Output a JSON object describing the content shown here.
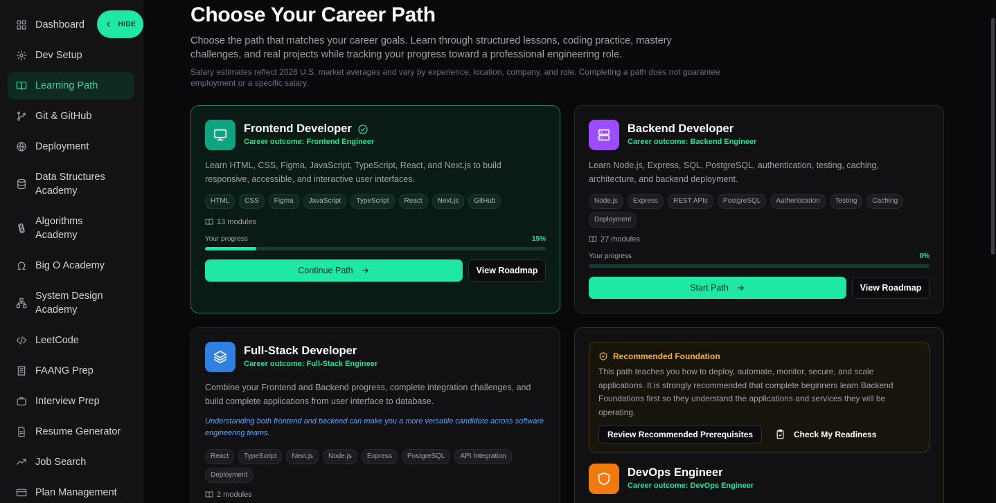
{
  "sidebar": {
    "hide_label": "HIDE",
    "items": [
      {
        "label": "Dashboard",
        "icon": "grid-icon"
      },
      {
        "label": "Dev Setup",
        "icon": "gear-icon"
      },
      {
        "label": "Learning Path",
        "icon": "book-open-icon",
        "active": true
      },
      {
        "label": "Git & GitHub",
        "icon": "git-branch-icon"
      },
      {
        "label": "Deployment",
        "icon": "globe-icon"
      },
      {
        "label": "Data Structures Academy",
        "icon": "database-icon"
      },
      {
        "label": "Algorithms Academy",
        "icon": "atom-icon"
      },
      {
        "label": "Big O Academy",
        "icon": "omega-icon"
      },
      {
        "label": "System Design Academy",
        "icon": "network-icon"
      },
      {
        "label": "LeetCode",
        "icon": "code-icon"
      },
      {
        "label": "FAANG Prep",
        "icon": "building-icon"
      },
      {
        "label": "Interview Prep",
        "icon": "briefcase-icon"
      },
      {
        "label": "Resume Generator",
        "icon": "file-icon"
      },
      {
        "label": "Job Search",
        "icon": "trending-icon"
      },
      {
        "label": "Plan Management",
        "icon": "card-icon"
      }
    ]
  },
  "header": {
    "title": "Choose Your Career Path",
    "description": "Choose the path that matches your career goals. Learn through structured lessons, coding practice, mastery challenges, and real projects while tracking your progress toward a professional engineering role.",
    "note": "Salary estimates reflect 2026 U.S. market averages and vary by experience, location, company, and role. Completing a path does not guarantee employment or a specific salary."
  },
  "cards": {
    "frontend": {
      "title": "Frontend Developer",
      "outcome": "Career outcome: Frontend Engineer",
      "description": "Learn HTML, CSS, Figma, JavaScript, TypeScript, React, and Next.js to build responsive, accessible, and interactive user interfaces.",
      "tags": [
        "HTML",
        "CSS",
        "Figma",
        "JavaScript",
        "TypeScript",
        "React",
        "Next.js",
        "GitHub"
      ],
      "modules": "13 modules",
      "progress_label": "Your progress",
      "progress_text": "15%",
      "progress": 0.15,
      "primary_label": "Continue Path",
      "secondary_label": "View Roadmap",
      "color": "#10a37f"
    },
    "backend": {
      "title": "Backend Developer",
      "outcome": "Career outcome: Backend Engineer",
      "description": "Learn Node.js, Express, SQL, PostgreSQL, authentication, testing, caching, architecture, and backend deployment.",
      "tags": [
        "Node.js",
        "Express",
        "REST APIs",
        "PostgreSQL",
        "Authentication",
        "Testing",
        "Caching",
        "Deployment"
      ],
      "modules": "27 modules",
      "progress_label": "Your progress",
      "progress_text": "0%",
      "progress": 0,
      "primary_label": "Start Path",
      "secondary_label": "View Roadmap",
      "color": "#9b4dff"
    },
    "fullstack": {
      "title": "Full-Stack Developer",
      "outcome": "Career outcome: Full-Stack Engineer",
      "description": "Combine your Frontend and Backend progress, complete integration challenges, and build complete applications from user interface to database.",
      "note": "Understanding both frontend and backend can make you a more versatile candidate across software engineering teams.",
      "tags": [
        "React",
        "TypeScript",
        "Next.js",
        "Node.js",
        "Express",
        "PostgreSQL",
        "API Integration",
        "Deployment"
      ],
      "modules": "2 modules",
      "color": "#2f80e0"
    },
    "devops": {
      "recommended_title": "Recommended Foundation",
      "recommended_text": "This path teaches you how to deploy, automate, monitor, secure, and scale applications. It is strongly recommended that complete beginners learn Backend Foundations first so they understand the applications and services they will be operating.",
      "review_label": "Review Recommended Prerequisites",
      "readiness_label": "Check My Readiness",
      "title": "DevOps Engineer",
      "outcome": "Career outcome: DevOps Engineer",
      "color": "#f07a10"
    }
  }
}
